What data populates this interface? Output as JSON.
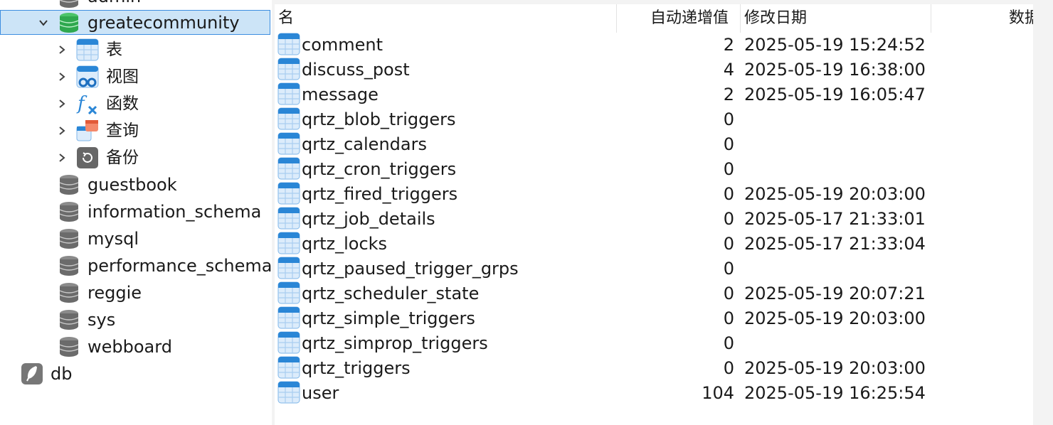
{
  "tree": {
    "top_partial_label": "admin",
    "selected_db": "greatecommunity",
    "children": [
      {
        "label": "表",
        "icon": "table-icon"
      },
      {
        "label": "视图",
        "icon": "view-icon"
      },
      {
        "label": "函数",
        "icon": "function-icon"
      },
      {
        "label": "查询",
        "icon": "query-icon"
      },
      {
        "label": "备份",
        "icon": "backup-icon"
      }
    ],
    "databases": [
      "guestbook",
      "information_schema",
      "mysql",
      "performance_schema",
      "reggie",
      "sys",
      "webboard"
    ],
    "connection": "db"
  },
  "grid": {
    "headers": {
      "name": "名",
      "auto_increment": "自动递增值",
      "modified": "修改日期",
      "data": "数据"
    },
    "rows": [
      {
        "name": "comment",
        "auto": "2",
        "date": "2025-05-19 15:24:52"
      },
      {
        "name": "discuss_post",
        "auto": "4",
        "date": "2025-05-19 16:38:00"
      },
      {
        "name": "message",
        "auto": "2",
        "date": "2025-05-19 16:05:47"
      },
      {
        "name": "qrtz_blob_triggers",
        "auto": "0",
        "date": ""
      },
      {
        "name": "qrtz_calendars",
        "auto": "0",
        "date": ""
      },
      {
        "name": "qrtz_cron_triggers",
        "auto": "0",
        "date": ""
      },
      {
        "name": "qrtz_fired_triggers",
        "auto": "0",
        "date": "2025-05-19 20:03:00"
      },
      {
        "name": "qrtz_job_details",
        "auto": "0",
        "date": "2025-05-17 21:33:01"
      },
      {
        "name": "qrtz_locks",
        "auto": "0",
        "date": "2025-05-17 21:33:04"
      },
      {
        "name": "qrtz_paused_trigger_grps",
        "auto": "0",
        "date": ""
      },
      {
        "name": "qrtz_scheduler_state",
        "auto": "0",
        "date": "2025-05-19 20:07:21"
      },
      {
        "name": "qrtz_simple_triggers",
        "auto": "0",
        "date": "2025-05-19 20:03:00"
      },
      {
        "name": "qrtz_simprop_triggers",
        "auto": "0",
        "date": ""
      },
      {
        "name": "qrtz_triggers",
        "auto": "0",
        "date": "2025-05-19 20:03:00"
      },
      {
        "name": "user",
        "auto": "104",
        "date": "2025-05-19 16:25:54"
      }
    ]
  },
  "colors": {
    "selection_bg": "#cce4f7",
    "selection_border": "#3d8ee0",
    "db_active": "#2fa84f",
    "db_inactive": "#6b6b6b",
    "table_icon": "#2a86d6"
  }
}
